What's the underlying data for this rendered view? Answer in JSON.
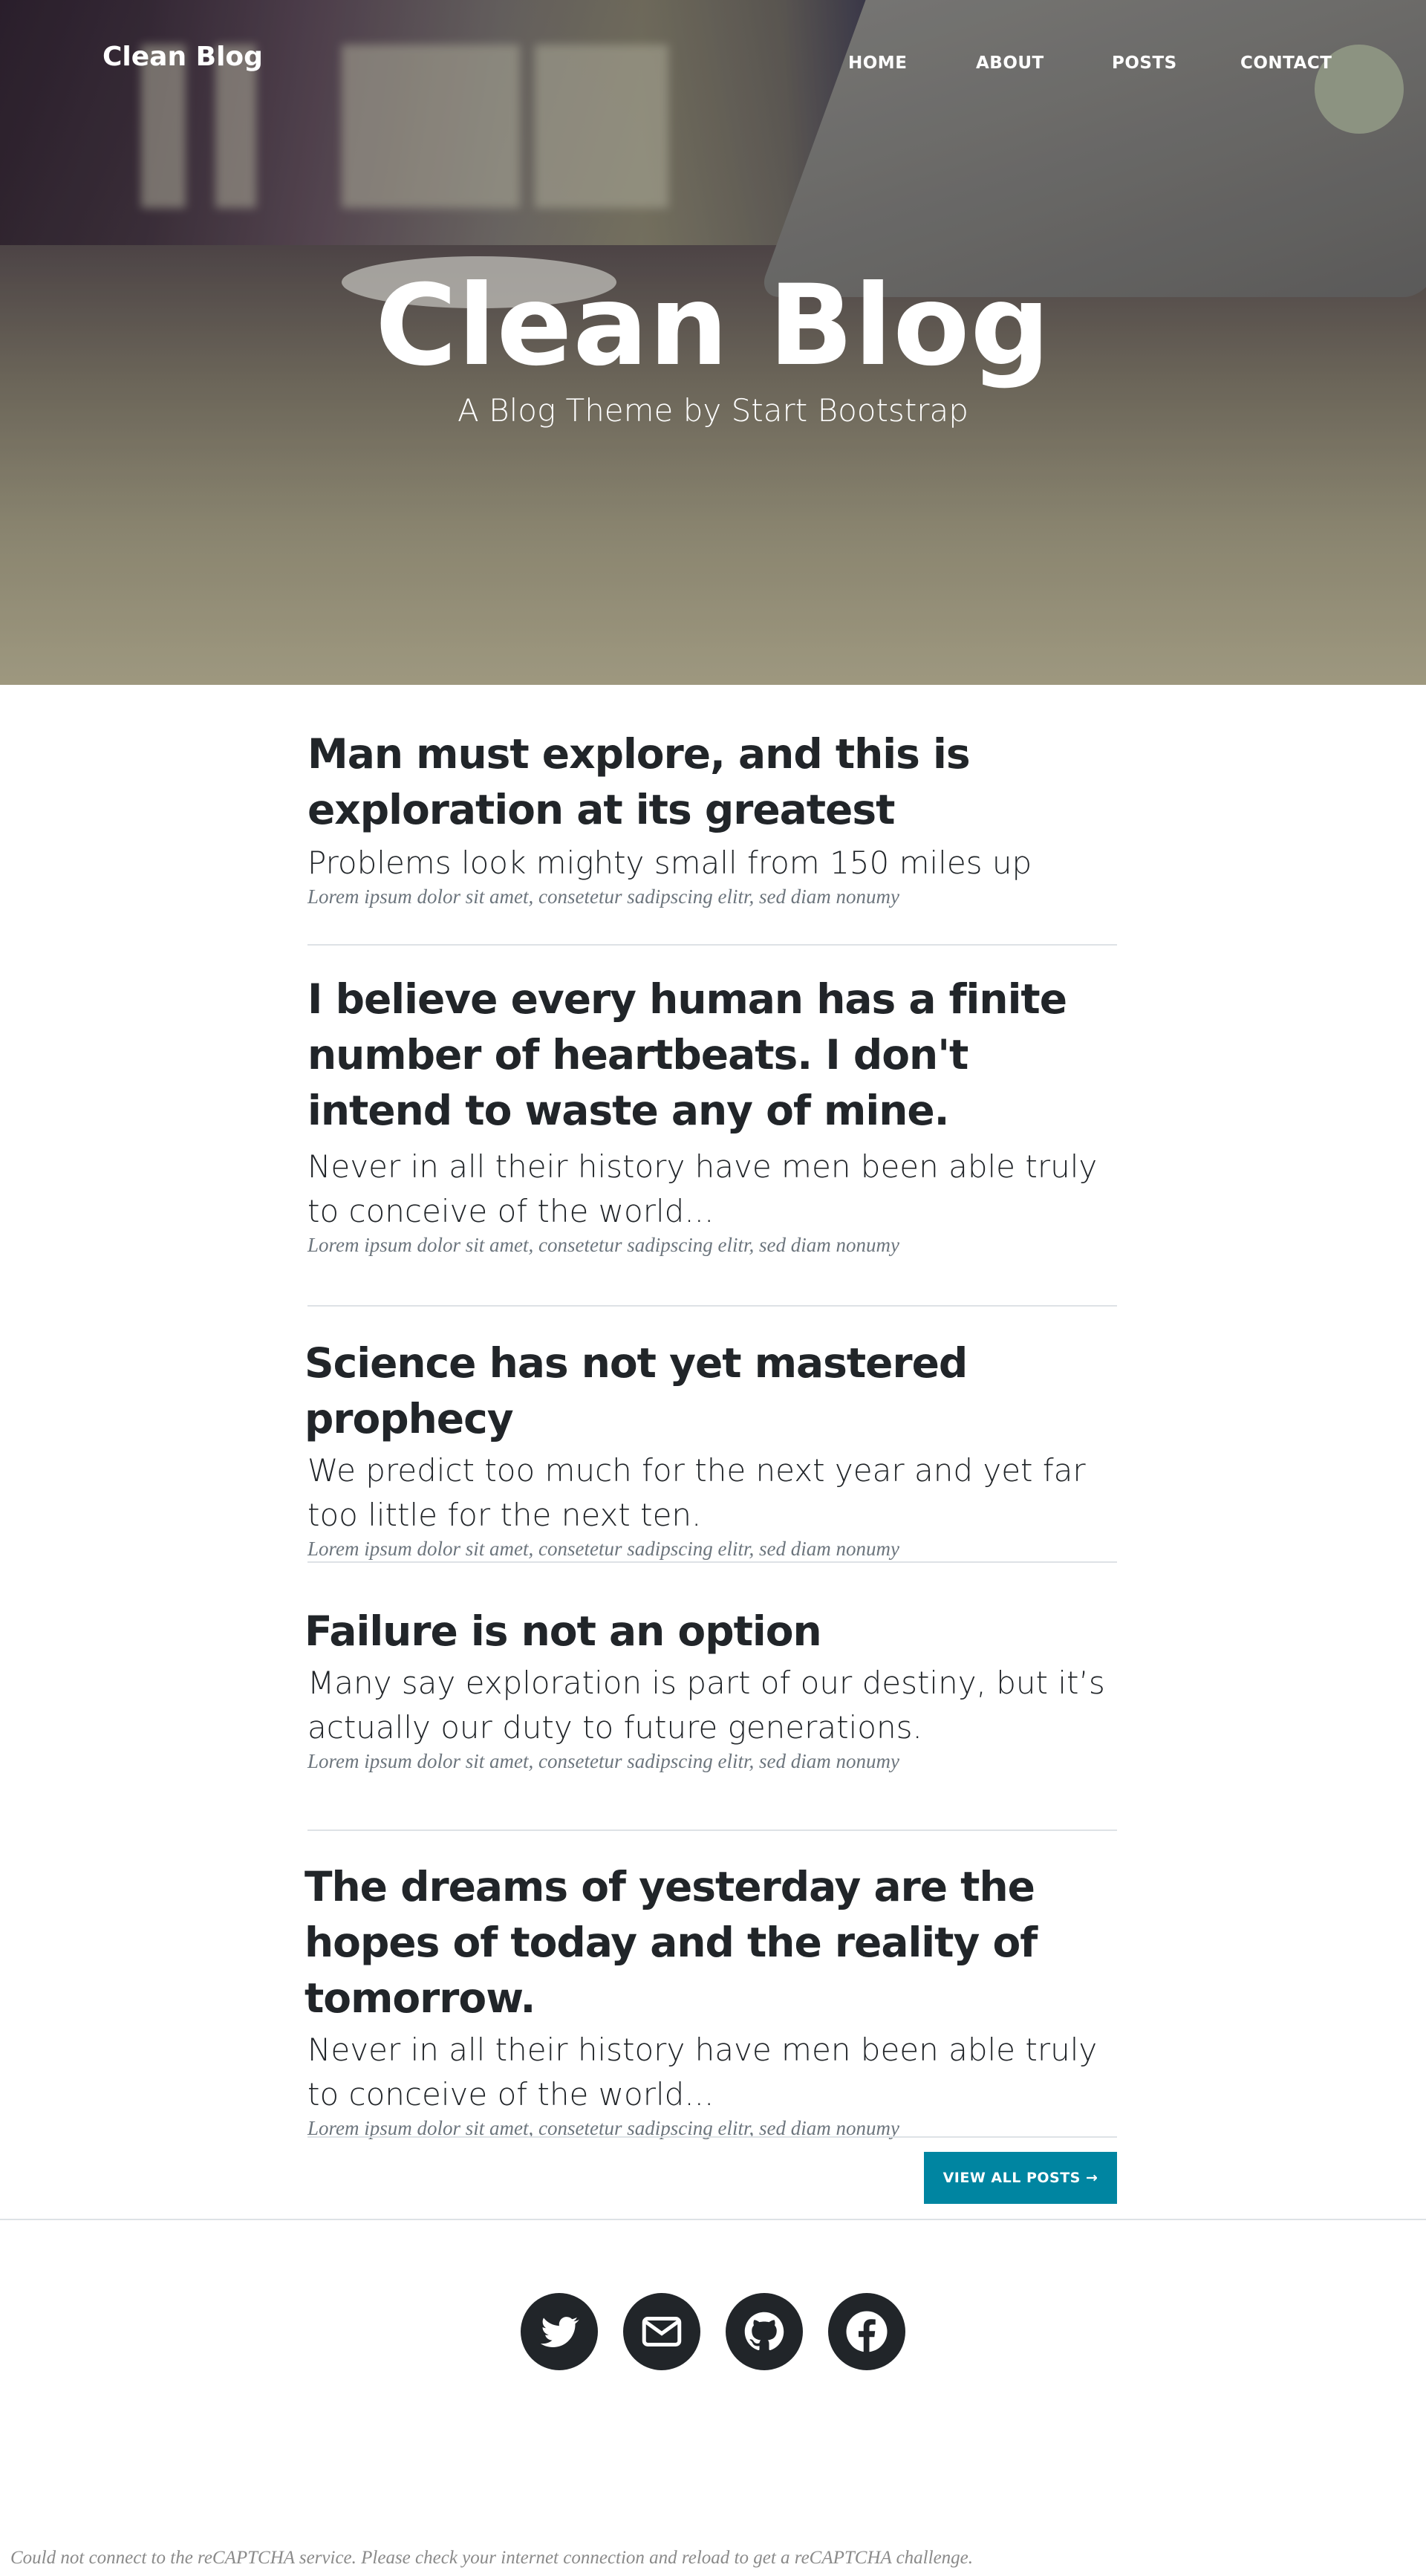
{
  "header": {
    "brand": "Clean Blog",
    "nav": [
      "HOME",
      "ABOUT",
      "POSTS",
      "CONTACT"
    ],
    "title": "Clean Blog",
    "subtitle": "A Blog Theme by Start Bootstrap"
  },
  "posts": [
    {
      "title": "Man must explore, and this is exploration at its greatest",
      "subtitle": "Problems look mighty small from 150 miles up",
      "meta": "Lorem ipsum dolor sit amet, consetetur sadipscing elitr, sed diam nonumy"
    },
    {
      "title": "I believe every human has a finite number of heartbeats. I don't intend to waste any of mine.",
      "subtitle": "Never in all their history have men been able truly to conceive of the world...",
      "meta": "Lorem ipsum dolor sit amet, consetetur sadipscing elitr, sed diam nonumy"
    },
    {
      "title": "Science has not yet mastered prophecy",
      "subtitle": "We predict too much for the next year and yet far too little for the next ten.",
      "meta": "Lorem ipsum dolor sit amet, consetetur sadipscing elitr, sed diam nonumy"
    },
    {
      "title": "Failure is not an option",
      "subtitle": "Many say exploration is part of our destiny, but it’s actually our duty to future generations.",
      "meta": "Lorem ipsum dolor sit amet, consetetur sadipscing elitr, sed diam nonumy"
    },
    {
      "title": "The dreams of yesterday are the hopes of today and the reality of tomorrow.",
      "subtitle": "Never in all their history have men been able truly to conceive of the world...",
      "meta": "Lorem ipsum dolor sit amet, consetetur sadipscing elitr, sed diam nonumy"
    }
  ],
  "pager": {
    "view_all_label": "VIEW ALL POSTS →"
  },
  "footer": {
    "social_icons": [
      "twitter-icon",
      "email-icon",
      "github-icon",
      "facebook-icon"
    ],
    "captcha_notice": "Could not connect to the reCAPTCHA service. Please check your internet connection and reload to get a reCAPTCHA challenge."
  },
  "colors": {
    "accent": "#0085a1",
    "text": "#212529",
    "muted": "#6c757d",
    "divider": "#dee2e6"
  }
}
